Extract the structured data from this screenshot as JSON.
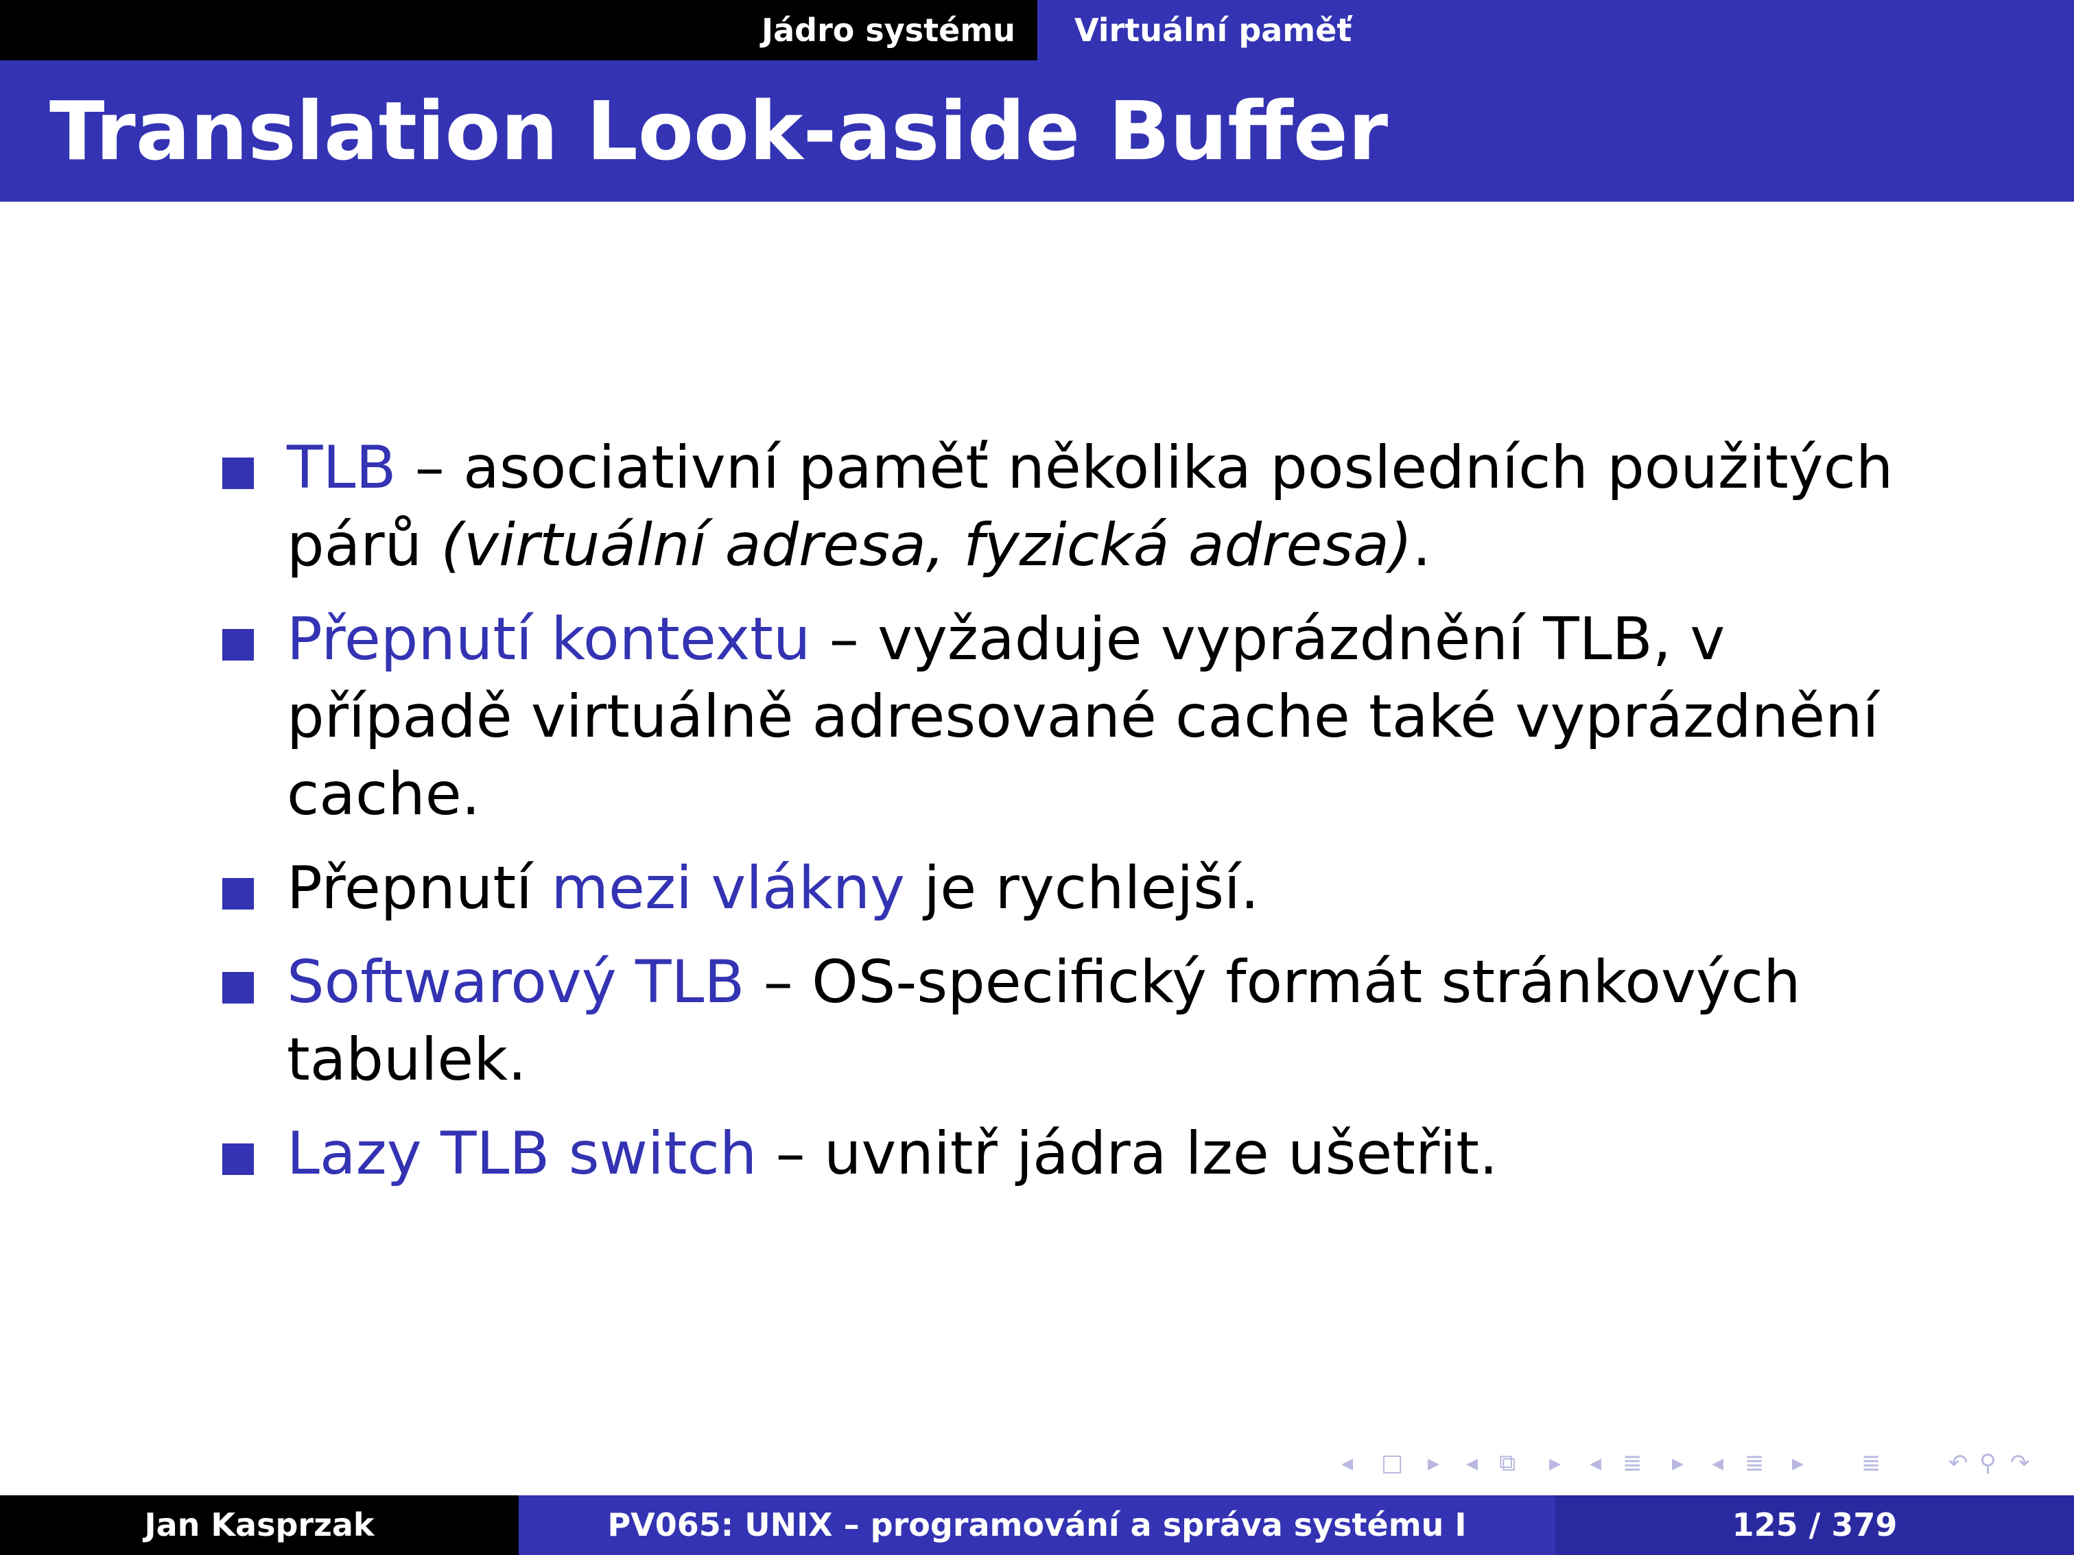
{
  "header": {
    "section_left": "Jádro systému",
    "section_right": "Virtuální paměť"
  },
  "slide": {
    "title": "Translation Look-aside Buffer",
    "bullets": [
      {
        "term": "TLB",
        "text": " – asociativní paměť několika posledních použitých párů ",
        "italic": "(virtuální adresa, fyzická adresa)",
        "end": "."
      },
      {
        "term": "Přepnutí kontextu",
        "text": " – vyžaduje vyprázdnění TLB, v případě virtuálně adresované cache také vyprázdnění cache."
      },
      {
        "pre": "Přepnutí ",
        "term": "mezi vlákny",
        "text": " je rychlejší."
      },
      {
        "term": "Softwarový TLB",
        "text": " – OS-specifický formát stránkových tabulek."
      },
      {
        "term": "Lazy TLB switch",
        "text": " – uvnitř jádra lze ušetřit."
      }
    ]
  },
  "footer": {
    "author": "Jan Kasprzak",
    "course": "PV065: UNIX – programování a správa systému I",
    "page": "125 / 379"
  },
  "colors": {
    "accent": "#3333b3",
    "dark": "#000000"
  },
  "nav_icons": [
    "arrow-left-icon",
    "frame-icon",
    "arrow-right-icon",
    "arrow-left-icon",
    "subsection-icon",
    "arrow-right-icon",
    "arrow-left-icon",
    "section-icon",
    "arrow-right-icon",
    "arrow-left-icon",
    "section-list-icon",
    "arrow-right-icon",
    "align-icon",
    "undo-icon",
    "search-icon",
    "redo-icon"
  ]
}
